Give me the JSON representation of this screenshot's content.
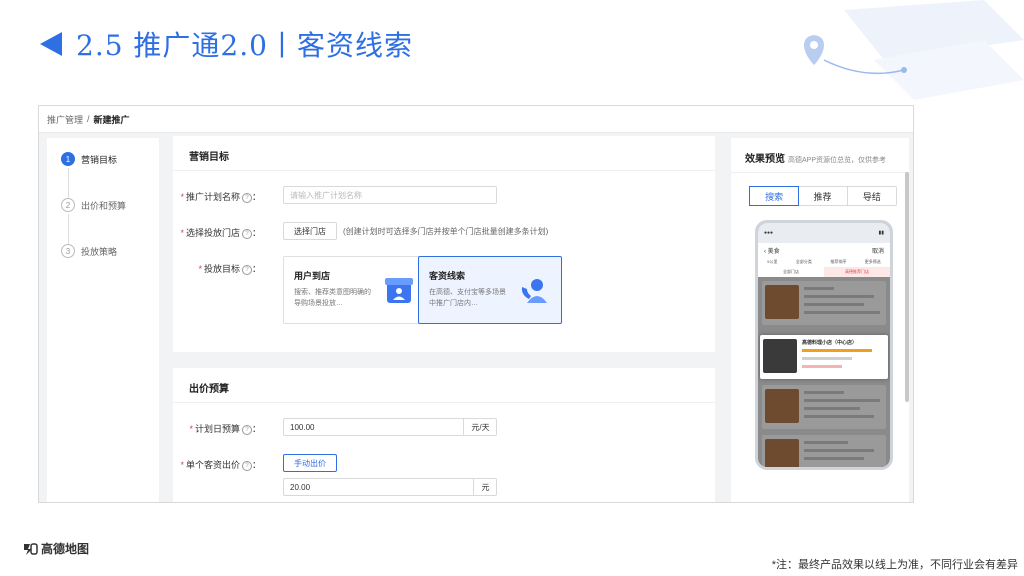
{
  "slide": {
    "title": "2.5 推广通2.0丨客资线索",
    "brand": "高德地图",
    "note": "*注：最终产品效果以线上为准，不同行业会有差异"
  },
  "breadcrumb": {
    "parent": "推广管理",
    "sep": "/",
    "current": "新建推广"
  },
  "steps": [
    {
      "num": "1",
      "label": "营销目标"
    },
    {
      "num": "2",
      "label": "出价和预算"
    },
    {
      "num": "3",
      "label": "投放策略"
    }
  ],
  "marketing": {
    "title": "营销目标",
    "plan_name_label": "推广计划名称",
    "plan_name_placeholder": "请输入推广计划名称",
    "store_label": "选择投放门店",
    "store_button": "选择门店",
    "store_hint": "(创建计划时可选择多门店并按单个门店批量创建多条计划)",
    "goal_label": "投放目标",
    "goals": [
      {
        "title": "用户到店",
        "desc": "搜索、推荐类意图明确的导购场景投放…"
      },
      {
        "title": "客资线索",
        "desc": "在高德、支付宝等多场景中推广门店内…"
      }
    ]
  },
  "bidding": {
    "title": "出价预算",
    "budget_label": "计划日预算",
    "budget_value": "100.00",
    "budget_unit": "元/天",
    "bid_label": "单个客资出价",
    "bid_button": "手动出价",
    "bid_value": "20.00",
    "bid_unit": "元"
  },
  "preview": {
    "title": "效果预览",
    "subtitle": "高德APP资源位总览，仅供参考",
    "tabs": [
      "搜索",
      "推荐",
      "导结"
    ],
    "active_tab": 0,
    "phone": {
      "search_query": "美食",
      "search_cancel": "取消",
      "filters": [
        "5公里",
        "全部分类",
        "推荐排序",
        "更多筛选"
      ],
      "sub_tabs": [
        "全部门店",
        "高德推荐门店"
      ],
      "highlight_name": "高德料理小店（中心店）",
      "colors": {
        "highlight": "#ffffff",
        "dim": "#8a8a8a"
      }
    }
  },
  "colors": {
    "accent": "#2f6fe4",
    "required": "#e04040"
  }
}
